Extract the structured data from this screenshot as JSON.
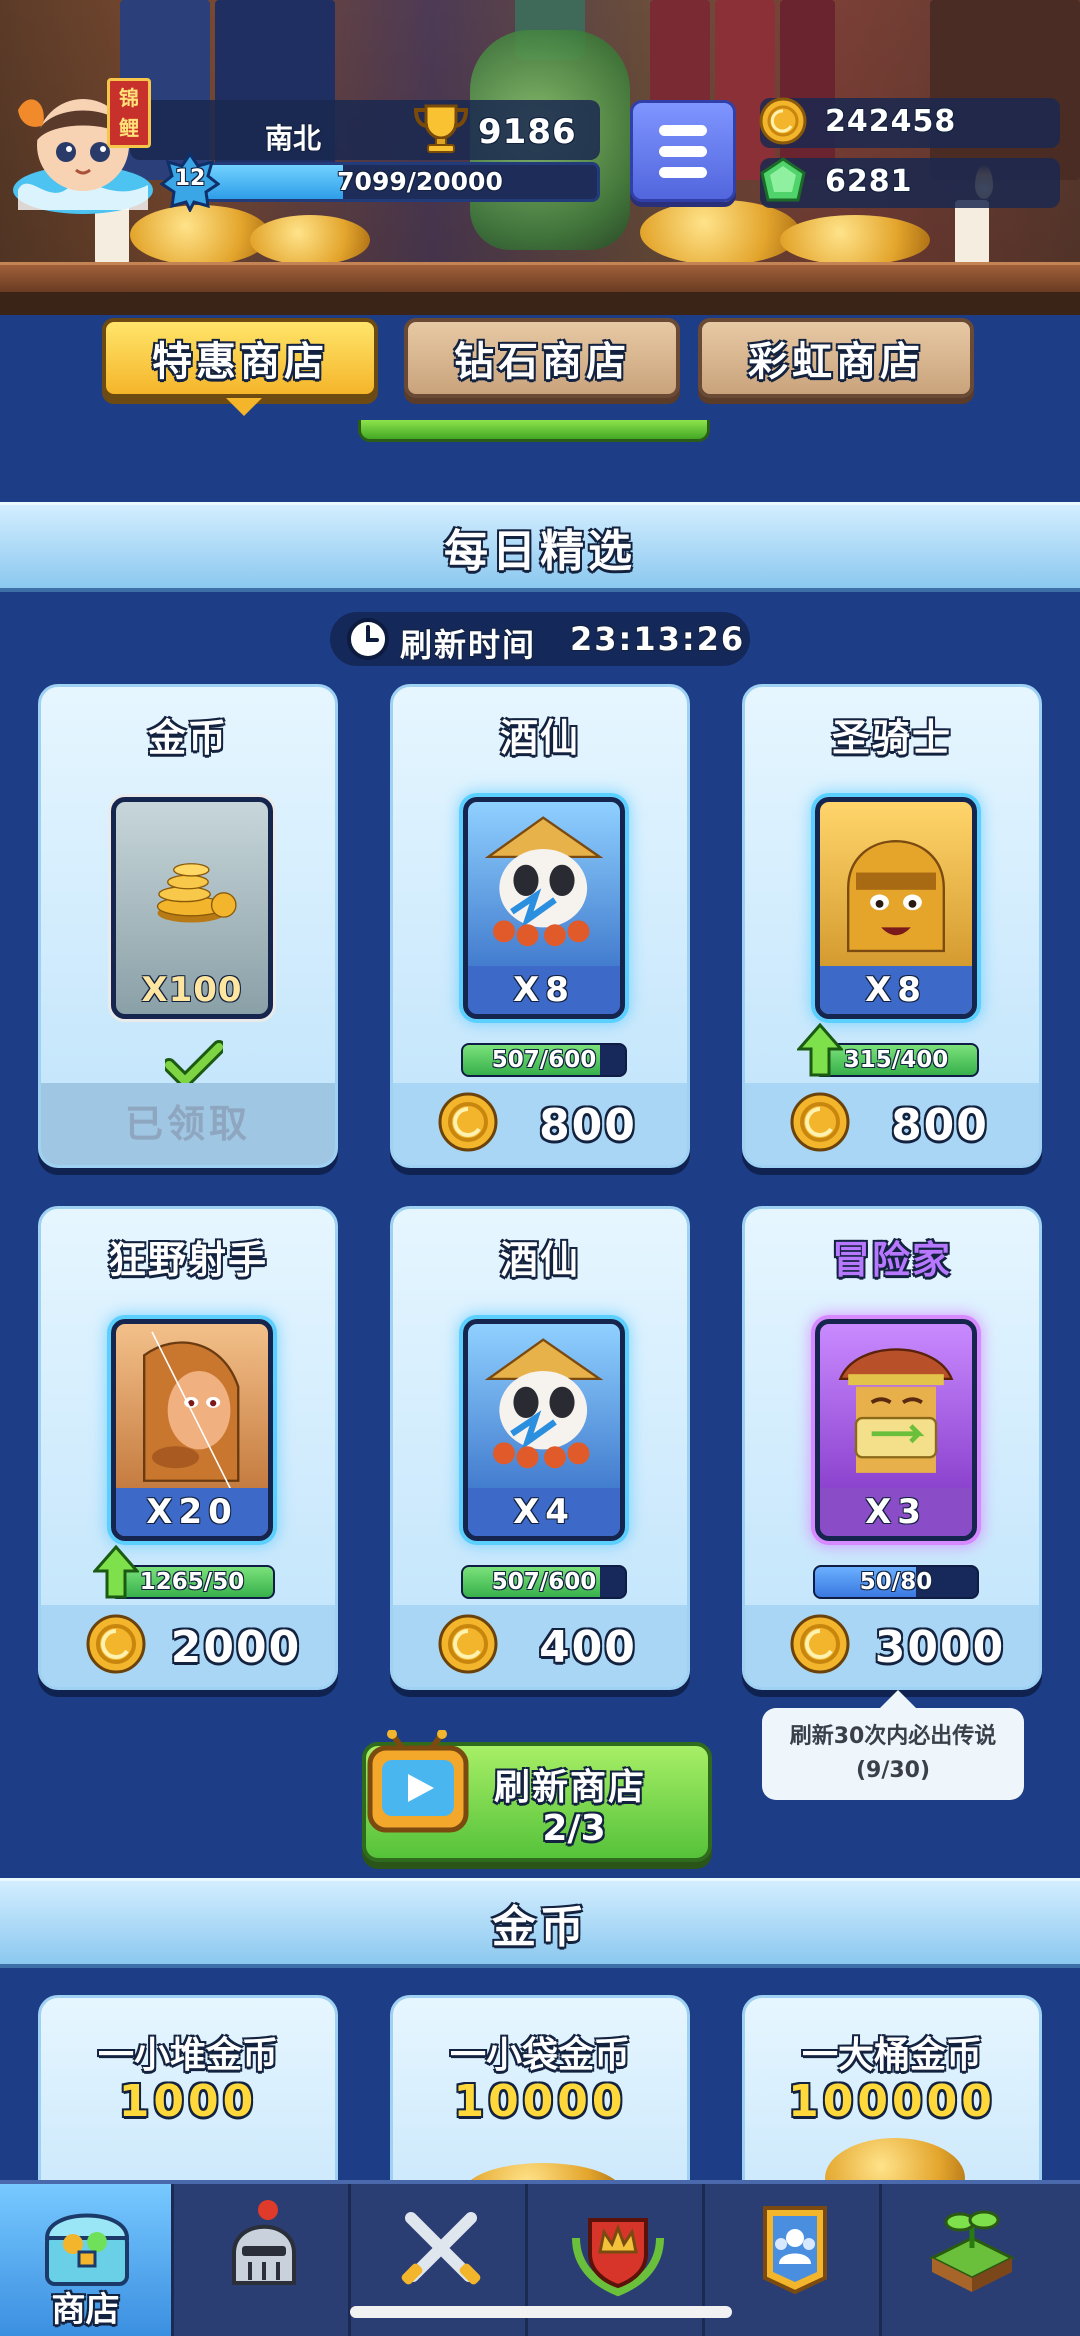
{
  "header": {
    "player_name": "南北",
    "koi_tag": "锦鲤",
    "trophies": "9186",
    "level": "12",
    "xp_text": "7099/20000",
    "xp_fraction": 0.355,
    "gold": "242458",
    "gems": "6281"
  },
  "tabs": [
    {
      "label": "特惠商店",
      "active": true
    },
    {
      "label": "钻石商店",
      "active": false
    },
    {
      "label": "彩虹商店",
      "active": false
    }
  ],
  "daily": {
    "title": "每日精选",
    "refresh_label": "刷新时间",
    "refresh_time": "23:13:26"
  },
  "cards": [
    {
      "name": "金币",
      "qty": "X100",
      "claimed_label": "已领取",
      "state": "claimed",
      "rarity": "gray"
    },
    {
      "name": "酒仙",
      "qty": "X8",
      "progress": "507/600",
      "progress_fraction": 0.845,
      "price": "800",
      "rarity": "blue",
      "upgrade": false
    },
    {
      "name": "圣骑士",
      "qty": "X8",
      "progress": "315/400",
      "progress_fraction": 1.0,
      "price": "800",
      "rarity": "blue",
      "upgrade": true
    },
    {
      "name": "狂野射手",
      "qty": "X20",
      "progress": "1265/50",
      "progress_fraction": 1.0,
      "price": "2000",
      "rarity": "blue",
      "upgrade": true
    },
    {
      "name": "酒仙",
      "qty": "X4",
      "progress": "507/600",
      "progress_fraction": 0.845,
      "price": "400",
      "rarity": "blue",
      "upgrade": false
    },
    {
      "name": "冒险家",
      "qty": "X3",
      "progress": "50/80",
      "progress_fraction": 0.625,
      "price": "3000",
      "rarity": "purple",
      "upgrade": false
    }
  ],
  "tooltip": {
    "line1": "刷新30次内必出传说",
    "line2": "(9/30)"
  },
  "refresh_button": {
    "label": "刷新商店",
    "count": "2/3"
  },
  "gold_section": {
    "title": "金币",
    "packs": [
      {
        "name": "一小堆金币",
        "amount": "1000"
      },
      {
        "name": "一小袋金币",
        "amount": "10000"
      },
      {
        "name": "一大桶金币",
        "amount": "100000"
      }
    ]
  },
  "nav": [
    {
      "label": "商店",
      "icon": "shop-chest-icon",
      "active": true
    },
    {
      "label": "",
      "icon": "knight-helmet-icon",
      "active": false
    },
    {
      "label": "",
      "icon": "crossed-swords-icon",
      "active": false
    },
    {
      "label": "",
      "icon": "crown-shield-icon",
      "active": false
    },
    {
      "label": "",
      "icon": "team-banner-icon",
      "active": false
    },
    {
      "label": "",
      "icon": "sprout-island-icon",
      "active": false
    }
  ],
  "colors": {
    "background": "#1d3d87",
    "tab_active": "#f5b52a",
    "rare_blue": "#5bd0ff",
    "epic_purple": "#b777ff",
    "gold_text": "#ffd93b",
    "green_button": "#55c23a"
  }
}
